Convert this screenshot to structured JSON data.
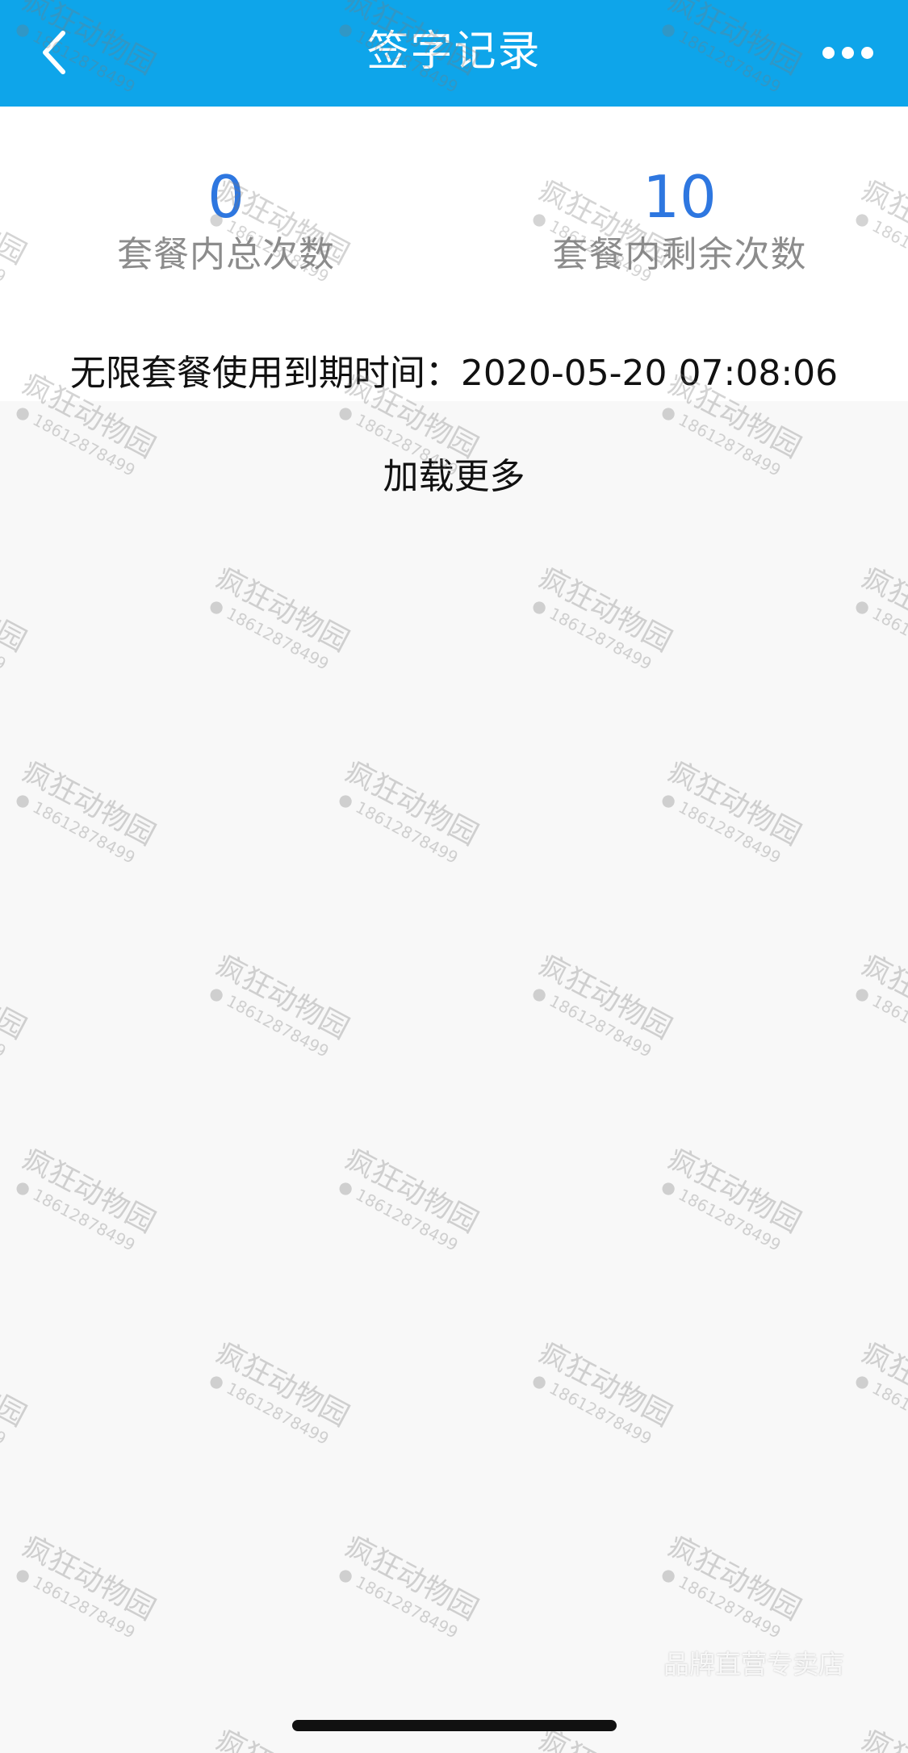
{
  "nav": {
    "back_icon": "chevron-left-icon",
    "title": "签字记录",
    "more_icon": "more-dots-icon"
  },
  "stats": {
    "total_value": "0",
    "total_label": "套餐内总次数",
    "remaining_value": "10",
    "remaining_label": "套餐内剩余次数"
  },
  "expiry_text": "无限套餐使用到期时间：2020-05-20 07:08:06",
  "load_more": "加载更多",
  "watermark": {
    "name": "疯狂动物园",
    "phone": "18612878499"
  },
  "store_badge": "品牌直营专卖店",
  "colors": {
    "nav_bg": "#0ea5ea",
    "stat_value": "#2e77e0",
    "stat_label": "#8c8c8c"
  }
}
